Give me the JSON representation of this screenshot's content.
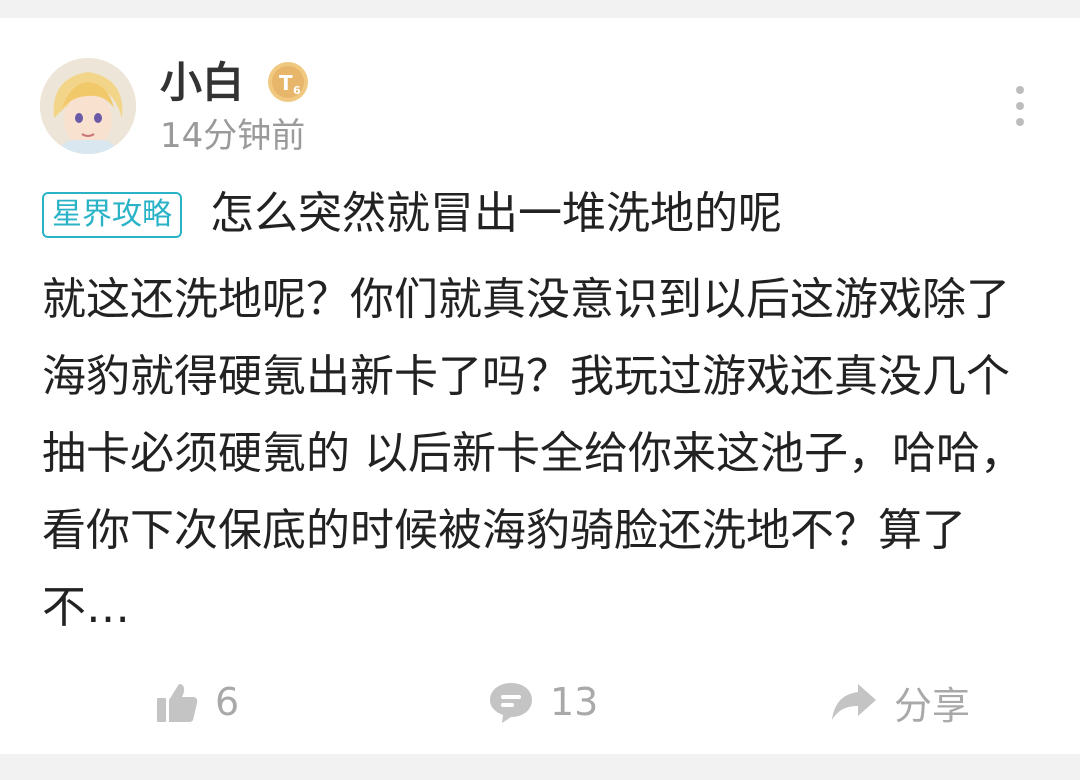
{
  "post": {
    "author": {
      "name": "小白",
      "level_badge": "T6",
      "avatar_icon": "anime-avatar-icon"
    },
    "timestamp": "14分钟前",
    "tag": "星界攻略",
    "title": "怎么突然就冒出一堆洗地的呢",
    "body": "就这还洗地呢？你们就真没意识到以后这游戏除了海豹就得硬氪出新卡了吗？我玩过游戏还真没几个抽卡必须硬氪的 以后新卡全给你来这池子，哈哈，看你下次保底的时候被海豹骑脸还洗地不？算了不…"
  },
  "actions": {
    "like_count": "6",
    "comment_count": "13",
    "share_label": "分享"
  },
  "colors": {
    "tag_accent": "#2ab3c7",
    "badge_gold": "#e7b66a",
    "text_primary": "#222222",
    "text_secondary": "#9a9a9a",
    "icon_gray": "#c4c4c4"
  },
  "icons": {
    "more": "more-vertical-icon",
    "like": "thumbs-up-icon",
    "comment": "comment-bubble-icon",
    "share": "share-arrow-icon"
  }
}
